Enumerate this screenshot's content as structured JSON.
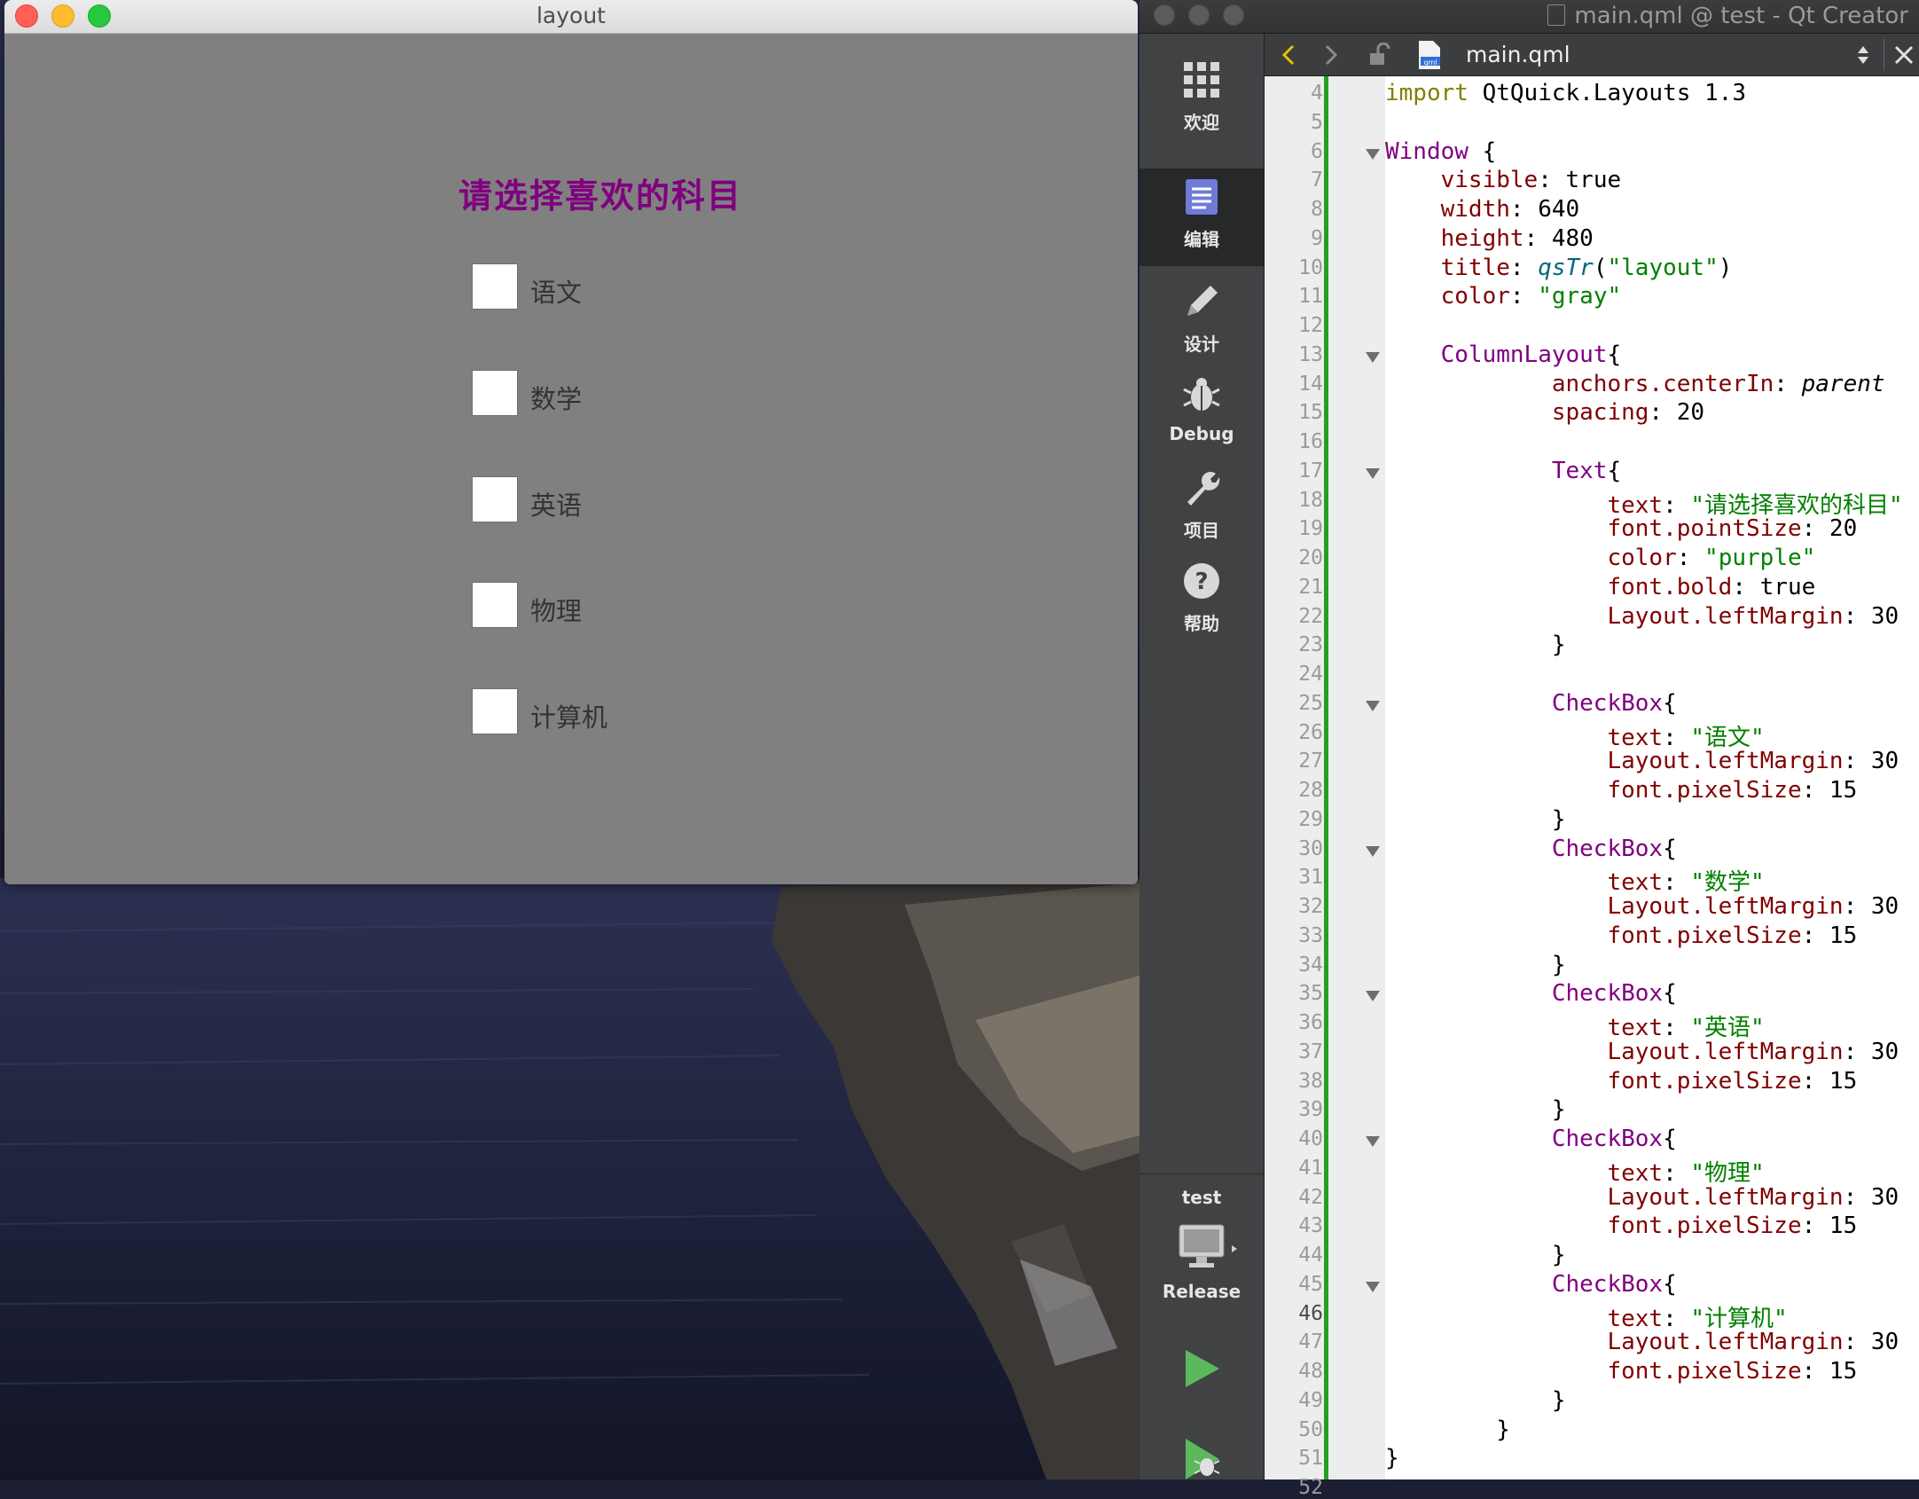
{
  "app_window": {
    "title": "layout",
    "heading": "请选择喜欢的科目",
    "checkboxes": [
      "语文",
      "数学",
      "英语",
      "物理",
      "计算机"
    ]
  },
  "creator": {
    "title": "main.qml @ test - Qt Creator",
    "file_name": "main.qml",
    "modes": [
      "欢迎",
      "编辑",
      "设计",
      "Debug",
      "项目",
      "帮助"
    ],
    "active_mode": "编辑",
    "kit": "test",
    "build_config": "Release",
    "current_line": 46,
    "code_lines": [
      {
        "n": 4,
        "parts": [
          [
            "k",
            "import"
          ],
          [
            "",
            " QtQuick.Layouts 1.3"
          ]
        ]
      },
      {
        "n": 5,
        "parts": []
      },
      {
        "n": 6,
        "fold": true,
        "parts": [
          [
            "t",
            "Window"
          ],
          [
            "",
            " {"
          ]
        ]
      },
      {
        "n": 7,
        "parts": [
          [
            "",
            "    "
          ],
          [
            "p",
            "visible"
          ],
          [
            "",
            ": true"
          ]
        ]
      },
      {
        "n": 8,
        "parts": [
          [
            "",
            "    "
          ],
          [
            "p",
            "width"
          ],
          [
            "",
            ": 640"
          ]
        ]
      },
      {
        "n": 9,
        "parts": [
          [
            "",
            "    "
          ],
          [
            "p",
            "height"
          ],
          [
            "",
            ": 480"
          ]
        ]
      },
      {
        "n": 10,
        "parts": [
          [
            "",
            "    "
          ],
          [
            "p",
            "title"
          ],
          [
            "",
            ": "
          ],
          [
            "f",
            "qsTr"
          ],
          [
            "",
            "("
          ],
          [
            "s",
            "\"layout\""
          ],
          [
            "",
            ")"
          ]
        ]
      },
      {
        "n": 11,
        "parts": [
          [
            "",
            "    "
          ],
          [
            "p",
            "color"
          ],
          [
            "",
            ": "
          ],
          [
            "s",
            "\"gray\""
          ]
        ]
      },
      {
        "n": 12,
        "parts": []
      },
      {
        "n": 13,
        "fold": true,
        "parts": [
          [
            "",
            "    "
          ],
          [
            "t",
            "ColumnLayout"
          ],
          [
            "",
            "{"
          ]
        ]
      },
      {
        "n": 14,
        "parts": [
          [
            "",
            "            "
          ],
          [
            "p",
            "anchors.centerIn"
          ],
          [
            "",
            ": "
          ],
          [
            "i",
            "parent"
          ]
        ]
      },
      {
        "n": 15,
        "parts": [
          [
            "",
            "            "
          ],
          [
            "p",
            "spacing"
          ],
          [
            "",
            ": 20"
          ]
        ]
      },
      {
        "n": 16,
        "parts": []
      },
      {
        "n": 17,
        "fold": true,
        "parts": [
          [
            "",
            "            "
          ],
          [
            "t",
            "Text"
          ],
          [
            "",
            "{"
          ]
        ]
      },
      {
        "n": 18,
        "parts": [
          [
            "",
            "                "
          ],
          [
            "p",
            "text"
          ],
          [
            "",
            ": "
          ],
          [
            "s",
            "\"请选择喜欢的科目\""
          ]
        ]
      },
      {
        "n": 19,
        "parts": [
          [
            "",
            "                "
          ],
          [
            "p",
            "font.pointSize"
          ],
          [
            "",
            ": 20"
          ]
        ]
      },
      {
        "n": 20,
        "parts": [
          [
            "",
            "                "
          ],
          [
            "p",
            "color"
          ],
          [
            "",
            ": "
          ],
          [
            "s",
            "\"purple\""
          ]
        ]
      },
      {
        "n": 21,
        "parts": [
          [
            "",
            "                "
          ],
          [
            "p",
            "font.bold"
          ],
          [
            "",
            ": true"
          ]
        ]
      },
      {
        "n": 22,
        "parts": [
          [
            "",
            "                "
          ],
          [
            "p",
            "Layout.leftMargin"
          ],
          [
            "",
            ": 30"
          ]
        ]
      },
      {
        "n": 23,
        "parts": [
          [
            "",
            "            }"
          ]
        ]
      },
      {
        "n": 24,
        "parts": []
      },
      {
        "n": 25,
        "fold": true,
        "parts": [
          [
            "",
            "            "
          ],
          [
            "t",
            "CheckBox"
          ],
          [
            "",
            "{"
          ]
        ]
      },
      {
        "n": 26,
        "parts": [
          [
            "",
            "                "
          ],
          [
            "p",
            "text"
          ],
          [
            "",
            ": "
          ],
          [
            "s",
            "\"语文\""
          ]
        ]
      },
      {
        "n": 27,
        "parts": [
          [
            "",
            "                "
          ],
          [
            "p",
            "Layout.leftMargin"
          ],
          [
            "",
            ": 30"
          ]
        ]
      },
      {
        "n": 28,
        "parts": [
          [
            "",
            "                "
          ],
          [
            "p",
            "font.pixelSize"
          ],
          [
            "",
            ": 15"
          ]
        ]
      },
      {
        "n": 29,
        "parts": [
          [
            "",
            "            }"
          ]
        ]
      },
      {
        "n": 30,
        "fold": true,
        "parts": [
          [
            "",
            "            "
          ],
          [
            "t",
            "CheckBox"
          ],
          [
            "",
            "{"
          ]
        ]
      },
      {
        "n": 31,
        "parts": [
          [
            "",
            "                "
          ],
          [
            "p",
            "text"
          ],
          [
            "",
            ": "
          ],
          [
            "s",
            "\"数学\""
          ]
        ]
      },
      {
        "n": 32,
        "parts": [
          [
            "",
            "                "
          ],
          [
            "p",
            "Layout.leftMargin"
          ],
          [
            "",
            ": 30"
          ]
        ]
      },
      {
        "n": 33,
        "parts": [
          [
            "",
            "                "
          ],
          [
            "p",
            "font.pixelSize"
          ],
          [
            "",
            ": 15"
          ]
        ]
      },
      {
        "n": 34,
        "parts": [
          [
            "",
            "            }"
          ]
        ]
      },
      {
        "n": 35,
        "fold": true,
        "parts": [
          [
            "",
            "            "
          ],
          [
            "t",
            "CheckBox"
          ],
          [
            "",
            "{"
          ]
        ]
      },
      {
        "n": 36,
        "parts": [
          [
            "",
            "                "
          ],
          [
            "p",
            "text"
          ],
          [
            "",
            ": "
          ],
          [
            "s",
            "\"英语\""
          ]
        ]
      },
      {
        "n": 37,
        "parts": [
          [
            "",
            "                "
          ],
          [
            "p",
            "Layout.leftMargin"
          ],
          [
            "",
            ": 30"
          ]
        ]
      },
      {
        "n": 38,
        "parts": [
          [
            "",
            "                "
          ],
          [
            "p",
            "font.pixelSize"
          ],
          [
            "",
            ": 15"
          ]
        ]
      },
      {
        "n": 39,
        "parts": [
          [
            "",
            "            }"
          ]
        ]
      },
      {
        "n": 40,
        "fold": true,
        "parts": [
          [
            "",
            "            "
          ],
          [
            "t",
            "CheckBox"
          ],
          [
            "",
            "{"
          ]
        ]
      },
      {
        "n": 41,
        "parts": [
          [
            "",
            "                "
          ],
          [
            "p",
            "text"
          ],
          [
            "",
            ": "
          ],
          [
            "s",
            "\"物理\""
          ]
        ]
      },
      {
        "n": 42,
        "parts": [
          [
            "",
            "                "
          ],
          [
            "p",
            "Layout.leftMargin"
          ],
          [
            "",
            ": 30"
          ]
        ]
      },
      {
        "n": 43,
        "parts": [
          [
            "",
            "                "
          ],
          [
            "p",
            "font.pixelSize"
          ],
          [
            "",
            ": 15"
          ]
        ]
      },
      {
        "n": 44,
        "parts": [
          [
            "",
            "            }"
          ]
        ]
      },
      {
        "n": 45,
        "fold": true,
        "parts": [
          [
            "",
            "            "
          ],
          [
            "t",
            "CheckBox"
          ],
          [
            "",
            "{"
          ]
        ]
      },
      {
        "n": 46,
        "parts": [
          [
            "",
            "                "
          ],
          [
            "p",
            "text"
          ],
          [
            "",
            ": "
          ],
          [
            "s",
            "\"计算机\""
          ]
        ]
      },
      {
        "n": 47,
        "parts": [
          [
            "",
            "                "
          ],
          [
            "p",
            "Layout.leftMargin"
          ],
          [
            "",
            ": 30"
          ]
        ]
      },
      {
        "n": 48,
        "parts": [
          [
            "",
            "                "
          ],
          [
            "p",
            "font.pixelSize"
          ],
          [
            "",
            ": 15"
          ]
        ]
      },
      {
        "n": 49,
        "parts": [
          [
            "",
            "            }"
          ]
        ]
      },
      {
        "n": 50,
        "parts": [
          [
            "",
            "        }"
          ]
        ]
      },
      {
        "n": 51,
        "parts": [
          [
            "",
            "}"
          ]
        ]
      },
      {
        "n": 52,
        "parts": []
      }
    ]
  }
}
